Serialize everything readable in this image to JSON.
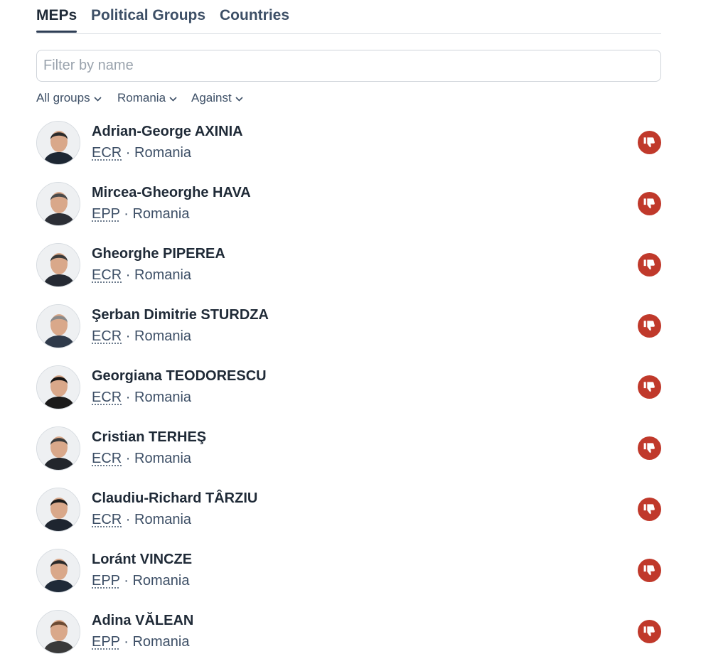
{
  "tabs": [
    {
      "label": "MEPs",
      "active": true
    },
    {
      "label": "Political Groups",
      "active": false
    },
    {
      "label": "Countries",
      "active": false
    }
  ],
  "filter": {
    "placeholder": "Filter by name",
    "value": ""
  },
  "selects": [
    {
      "label": "All groups"
    },
    {
      "label": "Romania"
    },
    {
      "label": "Against"
    }
  ],
  "separator": " · ",
  "colors": {
    "vote_against": "#c0392b",
    "text": "#1f2a37",
    "muted": "#3d4f66"
  },
  "meps": [
    {
      "name": "Adrian-George AXINIA",
      "group": "ECR",
      "country": "Romania",
      "vote": "Against",
      "vote_icon": "thumbs-down-icon"
    },
    {
      "name": "Mircea-Gheorghe HAVA",
      "group": "EPP",
      "country": "Romania",
      "vote": "Against",
      "vote_icon": "thumbs-down-icon"
    },
    {
      "name": "Gheorghe PIPEREA",
      "group": "ECR",
      "country": "Romania",
      "vote": "Against",
      "vote_icon": "thumbs-down-icon"
    },
    {
      "name": "Şerban Dimitrie STURDZA",
      "group": "ECR",
      "country": "Romania",
      "vote": "Against",
      "vote_icon": "thumbs-down-icon"
    },
    {
      "name": "Georgiana TEODORESCU",
      "group": "ECR",
      "country": "Romania",
      "vote": "Against",
      "vote_icon": "thumbs-down-icon"
    },
    {
      "name": "Cristian TERHEŞ",
      "group": "ECR",
      "country": "Romania",
      "vote": "Against",
      "vote_icon": "thumbs-down-icon"
    },
    {
      "name": "Claudiu-Richard TÂRZIU",
      "group": "ECR",
      "country": "Romania",
      "vote": "Against",
      "vote_icon": "thumbs-down-icon"
    },
    {
      "name": "Loránt VINCZE",
      "group": "EPP",
      "country": "Romania",
      "vote": "Against",
      "vote_icon": "thumbs-down-icon"
    },
    {
      "name": "Adina VĂLEAN",
      "group": "EPP",
      "country": "Romania",
      "vote": "Against",
      "vote_icon": "thumbs-down-icon"
    }
  ]
}
